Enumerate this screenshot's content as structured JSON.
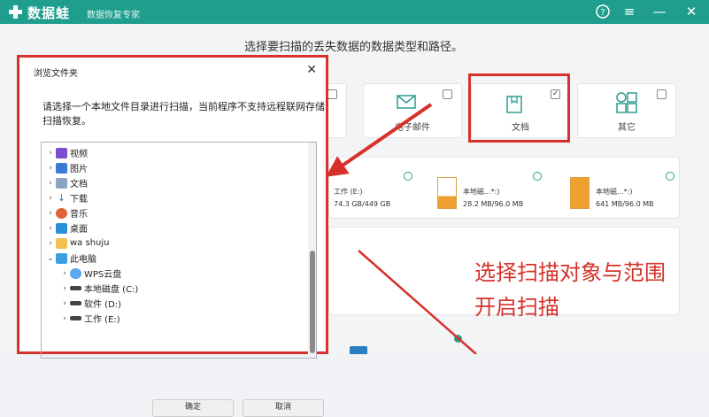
{
  "titlebar": {
    "app_name": "数据蛙",
    "subtitle": "数据恢复专家",
    "help_icon": "?",
    "menu_icon": "≡",
    "minimize_icon": "—",
    "close_icon": "✕",
    "bg_color": "#1f9e8e"
  },
  "main": {
    "instruction": "选择要扫描的丢失数据的数据类型和路径。",
    "file_types": [
      {
        "label": "",
        "icon": "image-icon",
        "checked": false
      },
      {
        "label": "电子邮件",
        "icon": "email-icon",
        "checked": false
      },
      {
        "label": "文档",
        "icon": "document-icon",
        "checked": true
      },
      {
        "label": "其它",
        "icon": "other-icon",
        "checked": false
      }
    ],
    "drives": [
      {
        "label": "工作 (E:)",
        "size": "74.3 GB/449 GB"
      },
      {
        "label": "本地磁...*:)",
        "size": "28.2 MB/96.0 MB"
      },
      {
        "label": "本地磁...*:)",
        "size": "641 MB/96.0 MB"
      }
    ],
    "callout_line1": "选择扫描对象与范围",
    "callout_line2": "开启扫描",
    "accent_red": "#d6312a"
  },
  "dialog": {
    "title": "浏览文件夹",
    "close": "✕",
    "description": "请选择一个本地文件目录进行扫描，当前程序不支持远程联网存储扫描恢复。",
    "tree": [
      {
        "label": "视频",
        "icon": "video-icon",
        "expanded": false,
        "indent": 0
      },
      {
        "label": "图片",
        "icon": "pictures-icon",
        "expanded": false,
        "indent": 0
      },
      {
        "label": "文档",
        "icon": "documents-icon",
        "expanded": false,
        "indent": 0
      },
      {
        "label": "下载",
        "icon": "downloads-icon",
        "expanded": false,
        "indent": 0
      },
      {
        "label": "音乐",
        "icon": "music-icon",
        "expanded": false,
        "indent": 0
      },
      {
        "label": "桌面",
        "icon": "desktop-icon",
        "expanded": false,
        "indent": 0
      },
      {
        "label": "wa shuju",
        "icon": "folder-icon",
        "expanded": false,
        "indent": 0
      },
      {
        "label": "此电脑",
        "icon": "computer-icon",
        "expanded": true,
        "indent": 0
      },
      {
        "label": "WPS云盘",
        "icon": "cloud-icon",
        "expanded": false,
        "indent": 1
      },
      {
        "label": "本地磁盘 (C:)",
        "icon": "drive-icon",
        "expanded": false,
        "indent": 1
      },
      {
        "label": "软件 (D:)",
        "icon": "drive-icon",
        "expanded": false,
        "indent": 1
      },
      {
        "label": "工作 (E:)",
        "icon": "drive-icon",
        "expanded": false,
        "indent": 1
      }
    ],
    "ok_label": "确定",
    "cancel_label": "取消"
  }
}
